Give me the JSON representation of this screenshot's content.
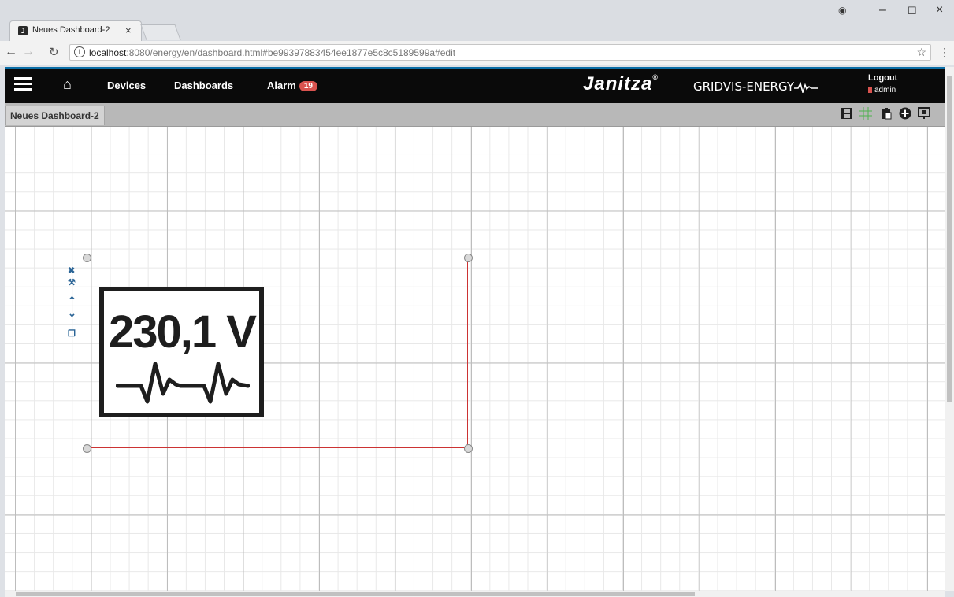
{
  "browser": {
    "tab_title": "Neues Dashboard-2",
    "tab_close": "×",
    "url_host": "localhost",
    "url_rest": ":8080/energy/en/dashboard.html#be99397883454ee1877e5c8c5189599a#edit",
    "window_controls": [
      "●",
      "–",
      "☐",
      "×"
    ]
  },
  "header": {
    "nav": {
      "devices": "Devices",
      "dashboards": "Dashboards",
      "alarm": "Alarm",
      "alarm_count": "19"
    },
    "brand": "Janitza",
    "brand_reg": "®",
    "brand_sub": "GRIDVIS-ENERGY",
    "logout": "Logout",
    "user": "admin"
  },
  "dashboard": {
    "tab_label": "Neues Dashboard-2",
    "toolbar_icons": [
      "save-icon",
      "grid-icon",
      "paste-icon",
      "add-icon",
      "presentation-icon"
    ]
  },
  "widget": {
    "value": "230,1 V",
    "tool_icons": [
      "close-icon",
      "wrench-icon",
      "chevron-up-icon",
      "chevron-down-icon",
      "copy-icon"
    ]
  },
  "colors": {
    "accent_red": "#cc3333",
    "header_bg": "#0a0a0a",
    "badge": "#d9534f",
    "link_blue": "#2a6496"
  }
}
